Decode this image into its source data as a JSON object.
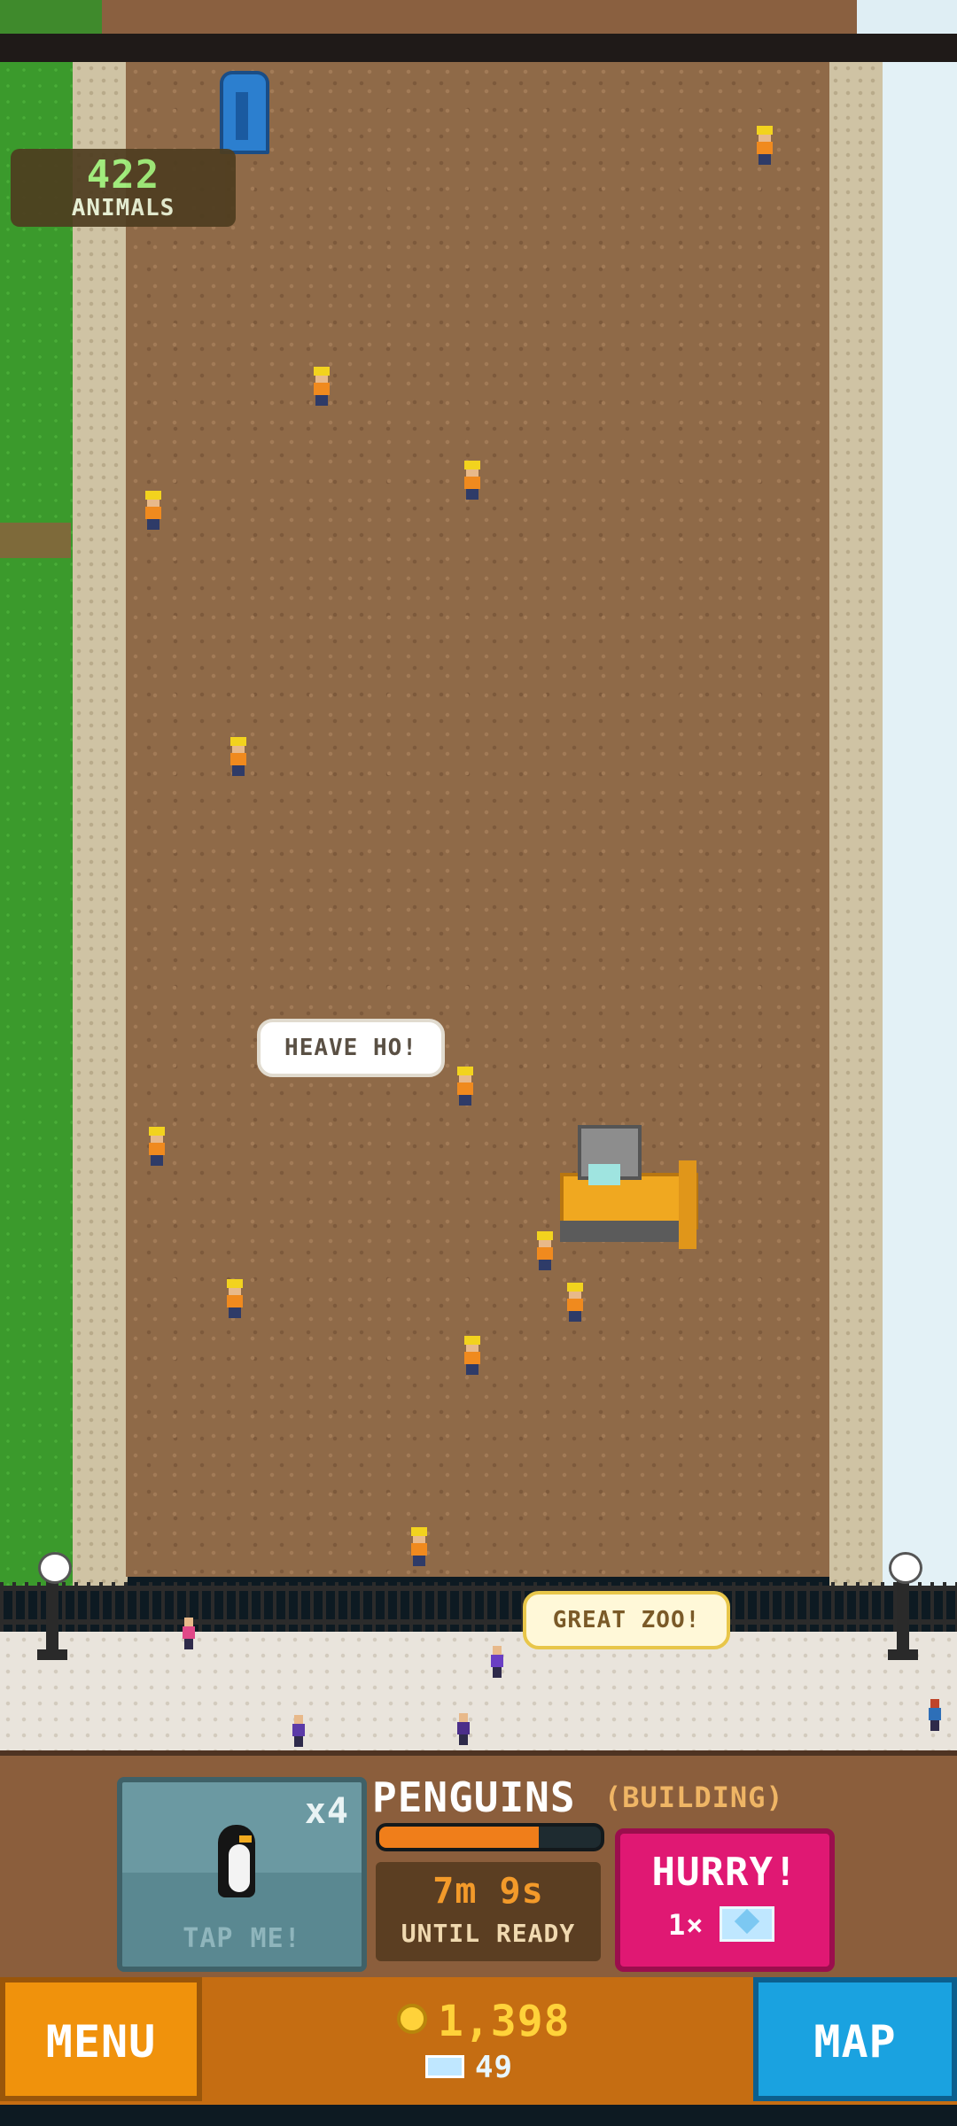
{
  "hud": {
    "animals_count": "422",
    "animals_label": "ANIMALS"
  },
  "bubbles": {
    "worker_shout": "HEAVE HO!",
    "visitor_comment": "GREAT ZOO!"
  },
  "exhibit": {
    "name": "PENGUINS",
    "state": "(BUILDING)",
    "multiplier": "x4",
    "tap_label": "TAP ME!",
    "progress_fraction": 0.72,
    "timer": "7m 9s",
    "timer_label": "UNTIL READY",
    "hurry_label": "HURRY!",
    "hurry_cost": "1×"
  },
  "bottom": {
    "menu_label": "MENU",
    "map_label": "MAP",
    "coins": "1,398",
    "gems": "49"
  },
  "colors": {
    "hurry": "#e01873",
    "menu": "#f0920c",
    "map": "#1aa2e0",
    "progress": "#f07e1a"
  }
}
